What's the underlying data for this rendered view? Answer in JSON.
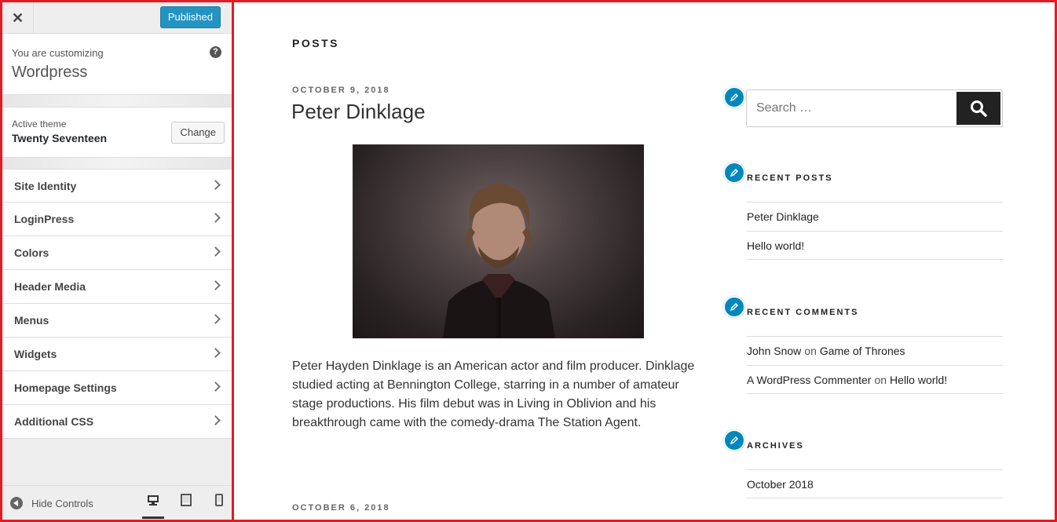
{
  "sidebar": {
    "close_label": "✕",
    "publish_label": "Published",
    "customizing_label": "You are customizing",
    "site_name": "Wordpress",
    "help_label": "?",
    "active_theme_label": "Active theme",
    "active_theme_name": "Twenty Seventeen",
    "change_label": "Change",
    "items": [
      {
        "label": "Site Identity"
      },
      {
        "label": "LoginPress"
      },
      {
        "label": "Colors"
      },
      {
        "label": "Header Media"
      },
      {
        "label": "Menus"
      },
      {
        "label": "Widgets"
      },
      {
        "label": "Homepage Settings"
      },
      {
        "label": "Additional CSS"
      }
    ],
    "hide_controls_label": "Hide Controls"
  },
  "preview": {
    "section_title": "POSTS",
    "posts": [
      {
        "date": "OCTOBER 9, 2018",
        "title": "Peter Dinklage",
        "excerpt": "Peter Hayden Dinklage is an American actor and film producer. Dinklage studied acting at Bennington College, starring in a number of amateur stage productions. His film debut was in Living in Oblivion and his breakthrough came with the comedy-drama The Station Agent."
      },
      {
        "date": "OCTOBER 6, 2018"
      }
    ],
    "search_placeholder": "Search …",
    "recent_posts_title": "RECENT POSTS",
    "recent_posts": [
      "Peter Dinklage",
      "Hello world!"
    ],
    "recent_comments_title": "RECENT COMMENTS",
    "recent_comments": [
      {
        "author": "John Snow",
        "on": "on",
        "post": "Game of Thrones"
      },
      {
        "author": "A WordPress Commenter",
        "on": "on",
        "post": "Hello world!"
      }
    ],
    "archives_title": "ARCHIVES",
    "archives": [
      "October 2018"
    ]
  },
  "colors": {
    "frame_border": "#e31b23",
    "publish_button": "#0085ba",
    "edit_shortcut": "#0087be"
  }
}
